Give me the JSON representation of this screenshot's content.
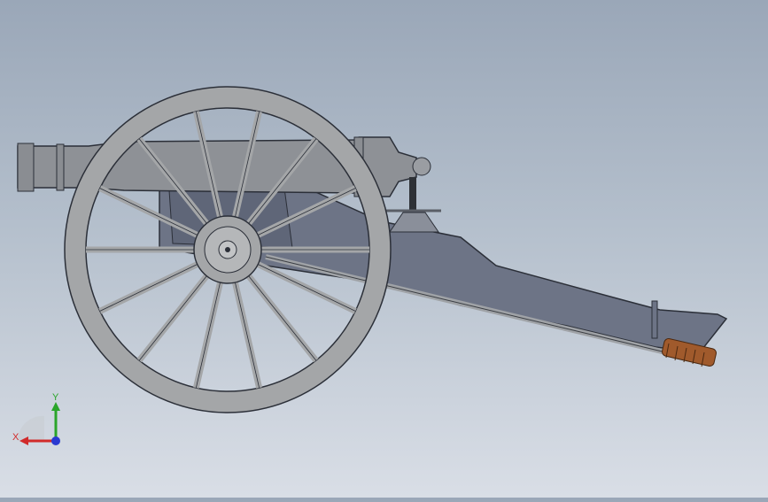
{
  "viewport": {
    "background_top": "#9aa7b8",
    "background_bottom": "#d9dee6",
    "model": {
      "barrel_color": "#8e9196",
      "carriage_color": "#6d7486",
      "wheel_color": "#a4a6a8",
      "rope_color": "#a05a2c"
    }
  },
  "triad": {
    "x_label": "X",
    "y_label": "Y",
    "x_color": "#d12a2a",
    "y_color": "#2aa52a",
    "z_color": "#2a3ad1"
  }
}
